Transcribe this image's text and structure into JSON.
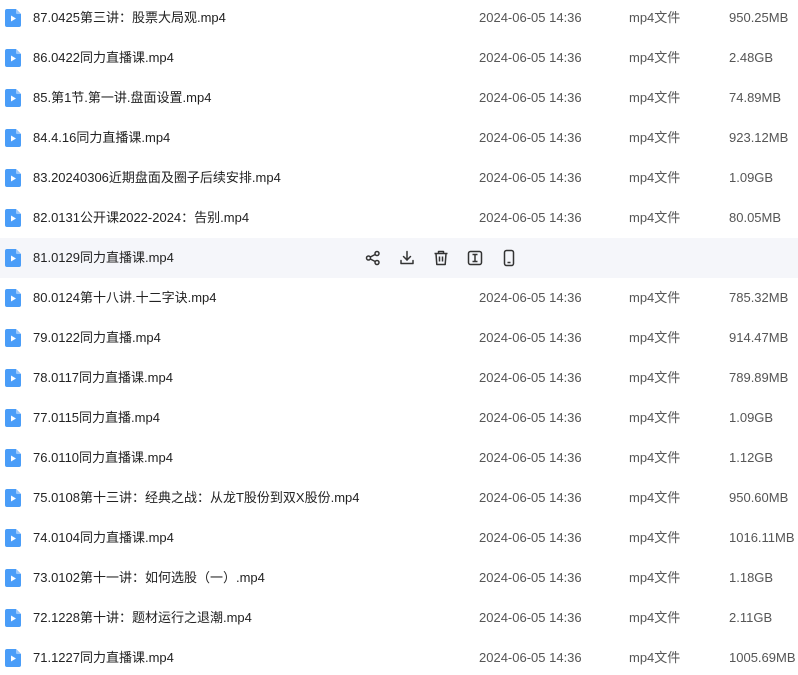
{
  "colors": {
    "icon_blue": "#4a9df8",
    "hover_row": "#f5f6fa",
    "action_icon": "#333333"
  },
  "files": [
    {
      "name": "87.0425第三讲：股票大局观.mp4",
      "date": "2024-06-05 14:36",
      "type": "mp4文件",
      "size": "950.25MB"
    },
    {
      "name": "86.0422同力直播课.mp4",
      "date": "2024-06-05 14:36",
      "type": "mp4文件",
      "size": "2.48GB"
    },
    {
      "name": "85.第1节.第一讲.盘面设置.mp4",
      "date": "2024-06-05 14:36",
      "type": "mp4文件",
      "size": "74.89MB"
    },
    {
      "name": "84.4.16同力直播课.mp4",
      "date": "2024-06-05 14:36",
      "type": "mp4文件",
      "size": "923.12MB"
    },
    {
      "name": "83.20240306近期盘面及圈子后续安排.mp4",
      "date": "2024-06-05 14:36",
      "type": "mp4文件",
      "size": "1.09GB"
    },
    {
      "name": "82.0131公开课2022-2024：告别.mp4",
      "date": "2024-06-05 14:36",
      "type": "mp4文件",
      "size": "80.05MB"
    },
    {
      "name": "81.0129同力直播课.mp4",
      "date": "",
      "type": "",
      "size": "",
      "hovered": true
    },
    {
      "name": "80.0124第十八讲.十二字诀.mp4",
      "date": "2024-06-05 14:36",
      "type": "mp4文件",
      "size": "785.32MB"
    },
    {
      "name": "79.0122同力直播.mp4",
      "date": "2024-06-05 14:36",
      "type": "mp4文件",
      "size": "914.47MB"
    },
    {
      "name": "78.0117同力直播课.mp4",
      "date": "2024-06-05 14:36",
      "type": "mp4文件",
      "size": "789.89MB"
    },
    {
      "name": "77.0115同力直播.mp4",
      "date": "2024-06-05 14:36",
      "type": "mp4文件",
      "size": "1.09GB"
    },
    {
      "name": "76.0110同力直播课.mp4",
      "date": "2024-06-05 14:36",
      "type": "mp4文件",
      "size": "1.12GB"
    },
    {
      "name": "75.0108第十三讲：经典之战：从龙T股份到双X股份.mp4",
      "date": "2024-06-05 14:36",
      "type": "mp4文件",
      "size": "950.60MB"
    },
    {
      "name": "74.0104同力直播课.mp4",
      "date": "2024-06-05 14:36",
      "type": "mp4文件",
      "size": "1016.11MB"
    },
    {
      "name": "73.0102第十一讲：如何选股（一）.mp4",
      "date": "2024-06-05 14:36",
      "type": "mp4文件",
      "size": "1.18GB"
    },
    {
      "name": "72.1228第十讲：题材运行之退潮.mp4",
      "date": "2024-06-05 14:36",
      "type": "mp4文件",
      "size": "2.11GB"
    },
    {
      "name": "71.1227同力直播课.mp4",
      "date": "2024-06-05 14:36",
      "type": "mp4文件",
      "size": "1005.69MB"
    }
  ],
  "row_actions": [
    {
      "icon": "share-icon"
    },
    {
      "icon": "download-icon"
    },
    {
      "icon": "trash-icon"
    },
    {
      "icon": "rename-icon"
    },
    {
      "icon": "mobile-icon"
    }
  ]
}
